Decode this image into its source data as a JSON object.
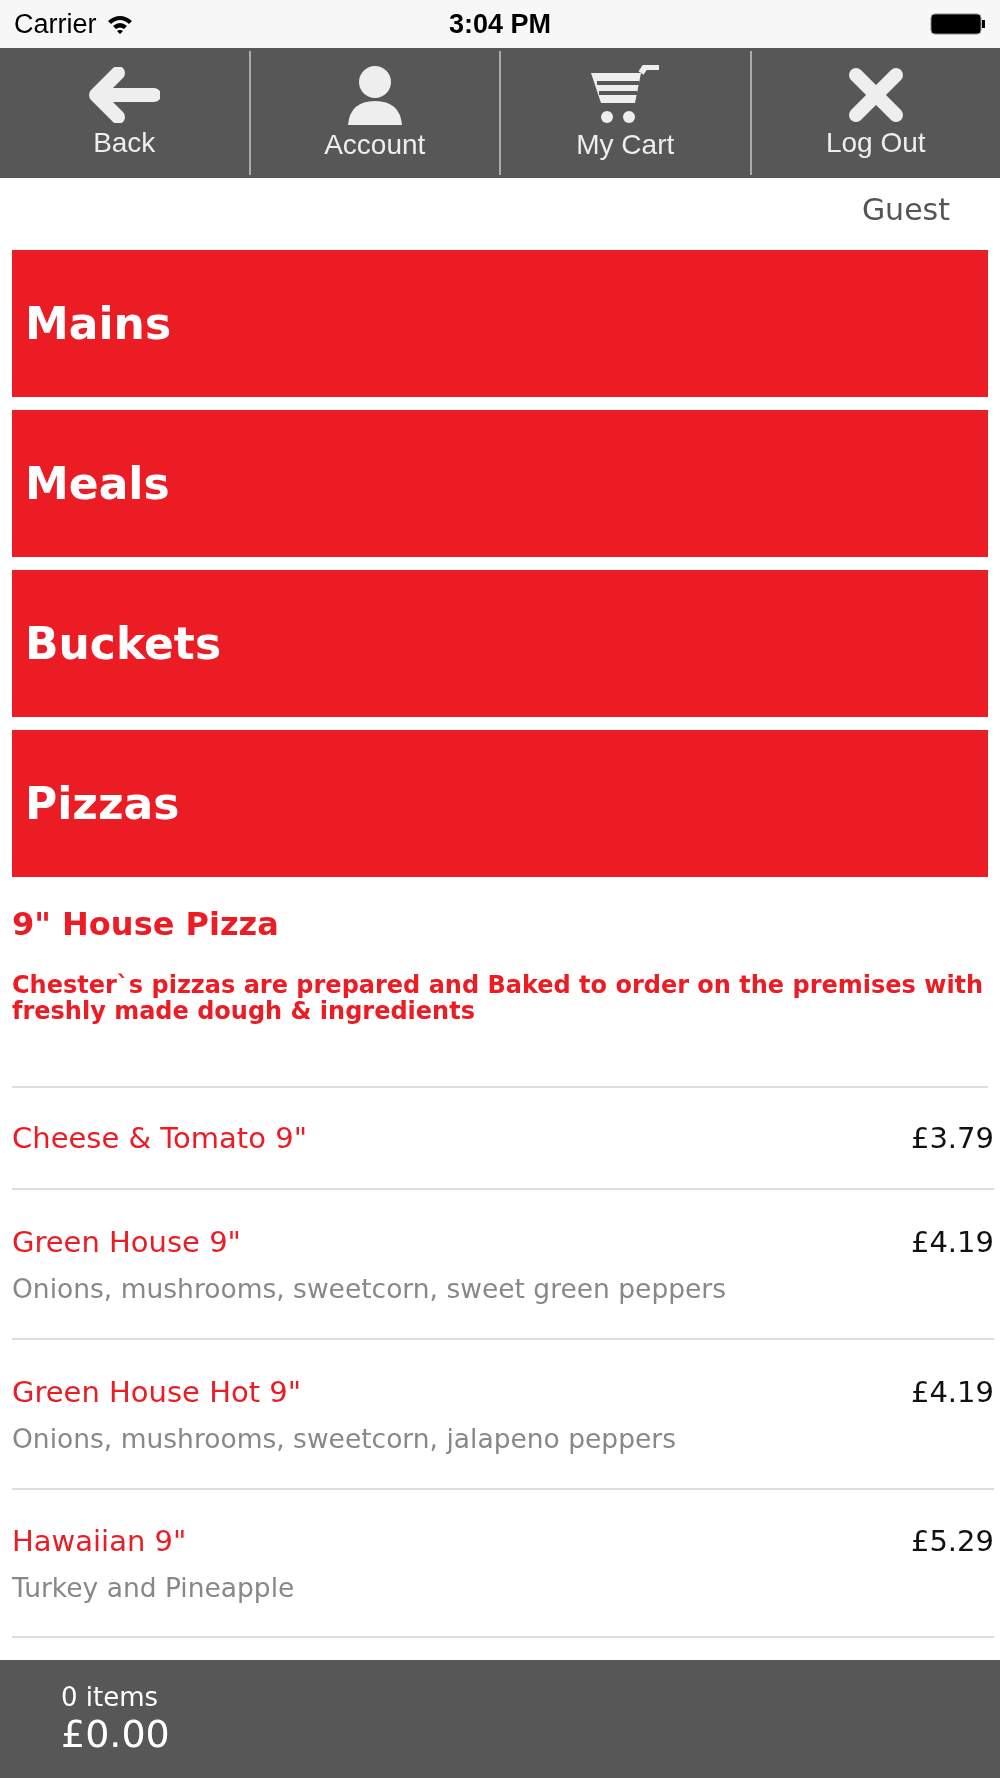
{
  "status_bar": {
    "carrier": "Carrier",
    "time": "3:04 PM"
  },
  "nav": [
    {
      "kind": "back",
      "label": "Back"
    },
    {
      "kind": "account",
      "label": "Account"
    },
    {
      "kind": "cart",
      "label": "My Cart"
    },
    {
      "kind": "logout",
      "label": "Log Out"
    }
  ],
  "user": "Guest",
  "categories": [
    "Mains",
    "Meals",
    "Buckets",
    "Pizzas"
  ],
  "section": {
    "title": "9\" House Pizza",
    "description": "Chester`s pizzas are prepared and Baked to order on the premises with freshly made dough & ingredients"
  },
  "items": [
    {
      "name": "Cheese & Tomato 9\"",
      "price": "£3.79"
    },
    {
      "name": "Green House 9\"",
      "price": "£4.19",
      "description": "Onions, mushrooms, sweetcorn, sweet green peppers"
    },
    {
      "name": "Green House Hot 9\"",
      "price": "£4.19",
      "description": "Onions, mushrooms, sweetcorn, jalapeno peppers"
    },
    {
      "name": "Hawaiian 9\"",
      "price": "£5.29",
      "description": "Turkey and Pineapple"
    }
  ],
  "cart": {
    "count": "0 items",
    "total": "£0.00"
  }
}
